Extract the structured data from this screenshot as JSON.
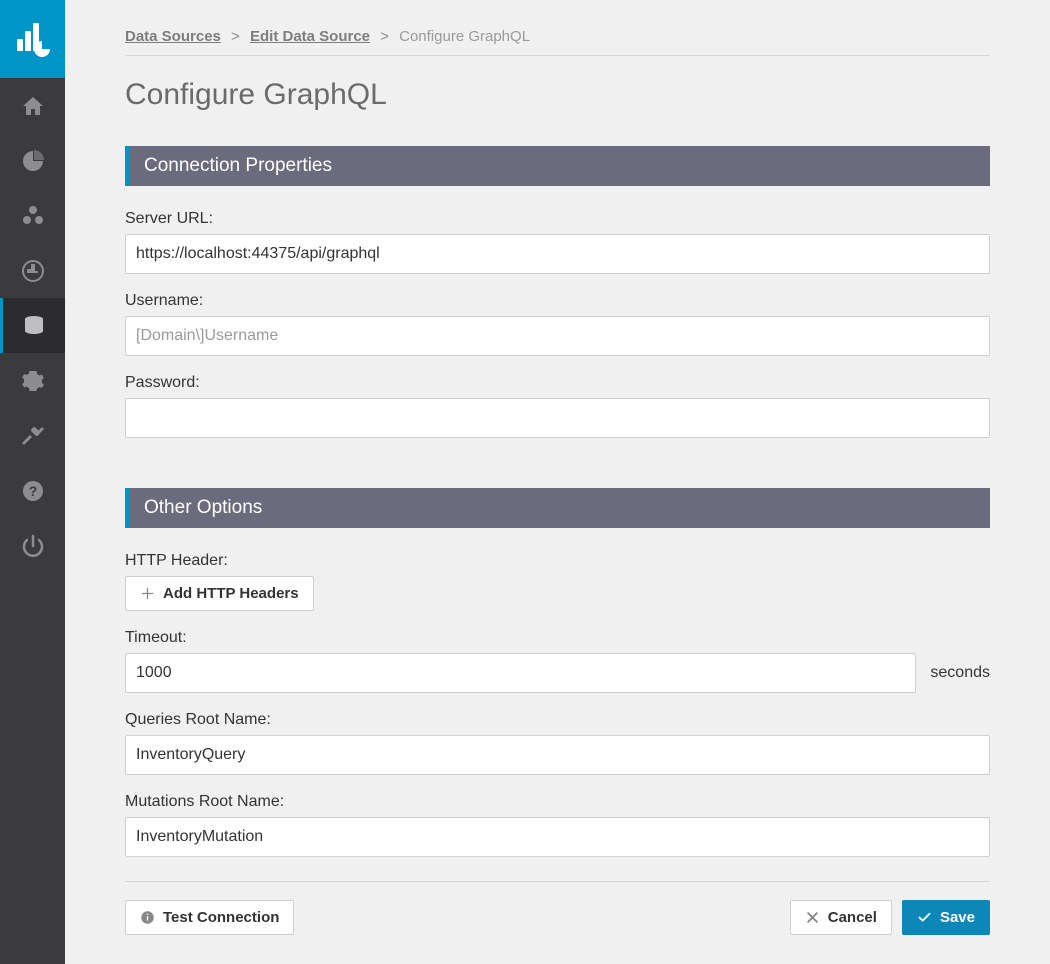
{
  "breadcrumb": {
    "link1": "Data Sources",
    "link2": "Edit Data Source",
    "current": "Configure GraphQL",
    "sep": ">"
  },
  "page_title": "Configure GraphQL",
  "sections": {
    "connection": {
      "title": "Connection Properties",
      "server_url_label": "Server URL:",
      "server_url_value": "https://localhost:44375/api/graphql",
      "username_label": "Username:",
      "username_placeholder": "[Domain\\]Username",
      "username_value": "",
      "password_label": "Password:",
      "password_value": ""
    },
    "other": {
      "title": "Other Options",
      "http_header_label": "HTTP Header:",
      "add_headers_button": "Add HTTP Headers",
      "timeout_label": "Timeout:",
      "timeout_value": "1000",
      "timeout_unit": "seconds",
      "queries_root_label": "Queries Root Name:",
      "queries_root_value": "InventoryQuery",
      "mutations_root_label": "Mutations Root Name:",
      "mutations_root_value": "InventoryMutation"
    }
  },
  "footer": {
    "test_connection": "Test Connection",
    "cancel": "Cancel",
    "save": "Save"
  },
  "sidebar": {
    "items": [
      {
        "name": "home"
      },
      {
        "name": "pie-chart"
      },
      {
        "name": "modules"
      },
      {
        "name": "history"
      },
      {
        "name": "database",
        "active": true
      },
      {
        "name": "settings"
      },
      {
        "name": "tools"
      },
      {
        "name": "help"
      },
      {
        "name": "power"
      }
    ]
  }
}
